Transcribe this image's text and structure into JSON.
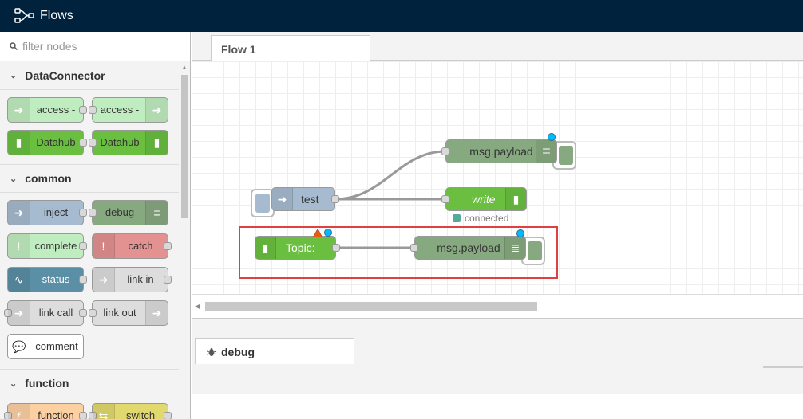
{
  "header": {
    "title": "Flows"
  },
  "palette": {
    "filter_placeholder": "filter nodes",
    "categories": [
      {
        "label": "DataConnector"
      },
      {
        "label": "common"
      },
      {
        "label": "function"
      }
    ],
    "nodes": {
      "access_in": "access -",
      "access_out": "access -",
      "datahub_sub": "Datahub",
      "datahub_pub": "Datahub",
      "inject": "inject",
      "debug": "debug",
      "complete": "complete",
      "catch": "catch",
      "status": "status",
      "link_in": "link in",
      "link_call": "link call",
      "link_out": "link out",
      "comment": "comment",
      "function": "function",
      "switch": "switch"
    }
  },
  "workspace": {
    "tab": "Flow 1",
    "nodes": {
      "debug_top": "msg.payload",
      "inject_test": "test",
      "write": "write",
      "write_status": "connected",
      "topic": "Topic:",
      "debug_bottom": "msg.payload"
    }
  },
  "sidebar": {
    "tab": "debug"
  },
  "colors": {
    "header_bg": "#00223d",
    "highlight": "#e04040",
    "datahub_green": "#6abf40",
    "debug_green": "#87a980",
    "inject_blue": "#a6bbcf"
  }
}
